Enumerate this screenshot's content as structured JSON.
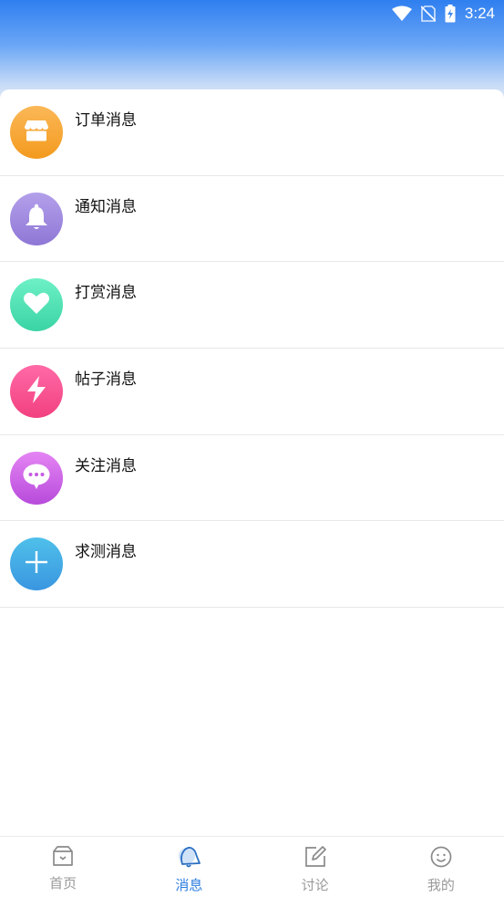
{
  "status_bar": {
    "time": "3:24",
    "icons": [
      "wifi-icon",
      "no-sim-icon",
      "battery-charging-icon"
    ]
  },
  "messages": {
    "items": [
      {
        "label": "订单消息",
        "icon": "store-icon",
        "color_from": "#fbb858",
        "color_to": "#f39a1e"
      },
      {
        "label": "通知消息",
        "icon": "bell-icon",
        "color_from": "#b3a0ea",
        "color_to": "#8e77d6"
      },
      {
        "label": "打赏消息",
        "icon": "heart-icon",
        "color_from": "#6ef0c6",
        "color_to": "#3ad4a4"
      },
      {
        "label": "帖子消息",
        "icon": "lightning-icon",
        "color_from": "#ff6aa7",
        "color_to": "#f2407f"
      },
      {
        "label": "关注消息",
        "icon": "chat-bubble-icon",
        "color_from": "#e585f4",
        "color_to": "#b74bdb"
      },
      {
        "label": "求测消息",
        "icon": "plus-icon",
        "color_from": "#4fc0ea",
        "color_to": "#3a96e0"
      }
    ]
  },
  "tabbar": {
    "tabs": [
      {
        "label": "首页",
        "icon": "home-box-icon",
        "active": false
      },
      {
        "label": "消息",
        "icon": "message-icon",
        "active": true
      },
      {
        "label": "讨论",
        "icon": "edit-icon",
        "active": false
      },
      {
        "label": "我的",
        "icon": "smiley-icon",
        "active": false
      }
    ],
    "active_color": "#2b7de0",
    "inactive_color": "#9a9a9a"
  }
}
